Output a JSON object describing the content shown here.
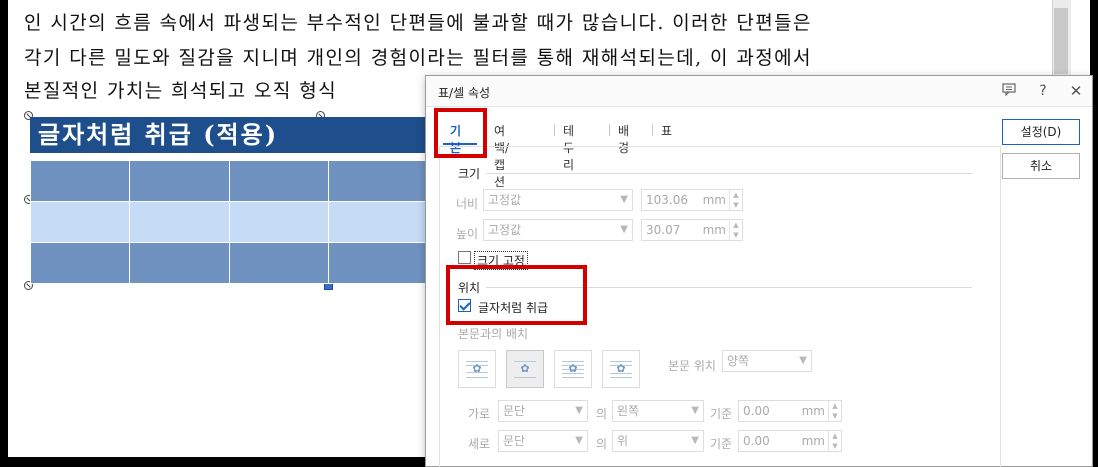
{
  "document": {
    "lines": [
      "인 시간의 흐름 속에서 파생되는 부수적인 단편들에 불과할 때가 많습니다. 이러한 단편들은",
      "각기 다른 밀도와 질감을 지니며 개인의 경험이라는 필터를 통해 재해석되는데, 이 과정에서",
      "본질적인 가치는 희석되고 오직 형식"
    ],
    "table_title": "글자처럼 취급 (적용)",
    "table_rows": 3,
    "table_cols": 4
  },
  "dialog": {
    "title": "표/셀 속성",
    "icons": [
      "comment-icon",
      "help-icon",
      "close-icon"
    ],
    "tabs": [
      "기본",
      "여백/캡션",
      "테두리",
      "배경",
      "표"
    ],
    "active_tab": "기본",
    "size_section": {
      "label": "크기",
      "width_label": "너비",
      "width_mode": "고정값",
      "width_value": "103.06",
      "height_label": "높이",
      "height_mode": "고정값",
      "height_value": "30.07",
      "unit": "mm",
      "fix_size_label": "크기 고정",
      "fix_size_checked": false
    },
    "position_section": {
      "label": "위치",
      "treat_as_char_label": "글자처럼 취급",
      "treat_as_char_checked": true,
      "wrap_label": "본문과의 배치",
      "body_pos_label": "본문 위치",
      "body_pos_value": "양쪽",
      "horizontal_label": "가로",
      "horizontal_ref": "문단",
      "horizontal_of": "의",
      "horizontal_align": "왼쪽",
      "horizontal_base_label": "기준",
      "horizontal_base_value": "0.00",
      "vertical_label": "세로",
      "vertical_ref": "문단",
      "vertical_of": "의",
      "vertical_align": "위",
      "vertical_base_label": "기준",
      "vertical_base_value": "0.00"
    },
    "buttons": {
      "ok": "설정(D)",
      "cancel": "취소"
    }
  },
  "colors": {
    "accent": "#1b62c4",
    "highlight_box": "#d40000",
    "table_header": "#1e4f8c",
    "table_dark": "#7092c0",
    "table_light": "#c6dbf5"
  }
}
